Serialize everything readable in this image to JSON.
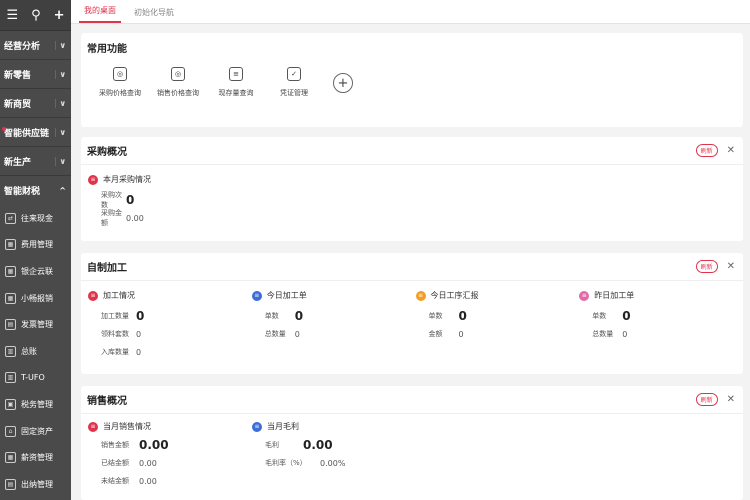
{
  "sidebar": {
    "top_icons": [
      "menu-icon",
      "search-icon",
      "plus-icon"
    ],
    "top_glyphs": [
      "☰",
      "⚲",
      "+"
    ],
    "nav": [
      {
        "label": "经营分析"
      },
      {
        "label": "新零售"
      },
      {
        "label": "新商贸"
      },
      {
        "label": "智能供应链"
      },
      {
        "label": "新生产"
      }
    ],
    "expanded": {
      "label": "智能财税",
      "chevron": "^"
    },
    "chevron": "∨",
    "sub_items": [
      {
        "label": "往来现金"
      },
      {
        "label": "费用管理"
      },
      {
        "label": "银企云联"
      },
      {
        "label": "小畅报销"
      },
      {
        "label": "发票管理"
      },
      {
        "label": "总账"
      },
      {
        "label": "T-UFO"
      },
      {
        "label": "税务管理"
      },
      {
        "label": "固定资产"
      },
      {
        "label": "薪资管理"
      },
      {
        "label": "出纳管理"
      }
    ]
  },
  "tabs": [
    {
      "label": "我的桌面"
    },
    {
      "label": "初始化导航"
    }
  ],
  "common": {
    "title": "常用功能",
    "items": [
      {
        "label": "采购价格查询"
      },
      {
        "label": "销售价格查询"
      },
      {
        "label": "现存量查询"
      },
      {
        "label": "凭证管理"
      }
    ],
    "add": "+"
  },
  "refresh_label": "刷新",
  "close_glyph": "✕",
  "purchase": {
    "title": "采购概况",
    "section": "本月采购情况",
    "rows": [
      {
        "label": "采购次数",
        "value": "0"
      },
      {
        "label": "采购金额",
        "value": "0.00"
      }
    ]
  },
  "processing": {
    "title": "自制加工",
    "cols": [
      {
        "head": "加工情况",
        "color": "#e0334c",
        "rows": [
          {
            "label": "加工数量",
            "value": "0",
            "big": true
          },
          {
            "label": "领料套数",
            "value": "0"
          },
          {
            "label": "入库数量",
            "value": "0"
          }
        ]
      },
      {
        "head": "今日加工单",
        "color": "#3b6ed8",
        "rows": [
          {
            "label": "单数",
            "value": "0",
            "big": true
          },
          {
            "label": "总数量",
            "value": "0"
          }
        ]
      },
      {
        "head": "今日工序汇报",
        "color": "#f29d25",
        "rows": [
          {
            "label": "单数",
            "value": "0",
            "big": true
          },
          {
            "label": "金额",
            "value": "0"
          }
        ]
      },
      {
        "head": "昨日加工单",
        "color": "#e06aa8",
        "rows": [
          {
            "label": "单数",
            "value": "0",
            "big": true
          },
          {
            "label": "总数量",
            "value": "0"
          }
        ]
      }
    ]
  },
  "sales": {
    "title": "销售概况",
    "cols": [
      {
        "head": "当月销售情况",
        "color": "#e0334c",
        "rows": [
          {
            "label": "销售金额",
            "value": "0.00",
            "big": true
          },
          {
            "label": "已结金额",
            "value": "0.00"
          },
          {
            "label": "未结金额",
            "value": "0.00"
          }
        ]
      },
      {
        "head": "当月毛利",
        "color": "#3b6ed8",
        "rows": [
          {
            "label": "毛利",
            "value": "0.00",
            "big": true
          },
          {
            "label": "毛利率（%）",
            "value": "0.00%"
          }
        ]
      }
    ]
  }
}
